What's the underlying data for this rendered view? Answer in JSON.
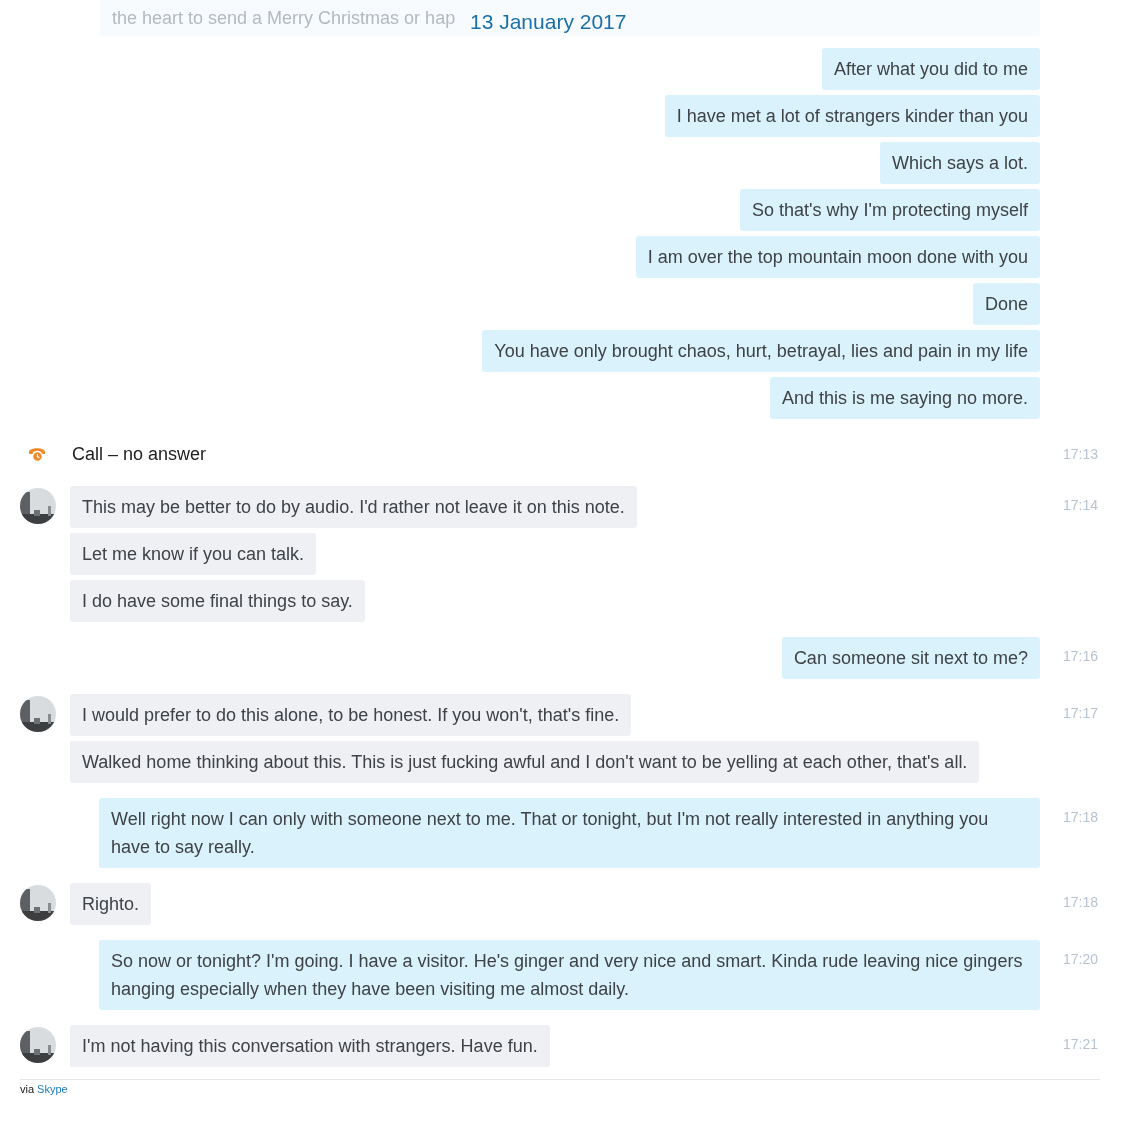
{
  "faded_message": "the heart to send a Merry Christmas or hap",
  "date_header": "13 January 2017",
  "groups": [
    {
      "kind": "out",
      "messages": [
        "After what you did to me",
        "I have met a lot of strangers kinder than you",
        "Which says a lot.",
        "So that's why I'm protecting myself",
        "I am over the top mountain moon done with you",
        "Done",
        "You have only brought chaos, hurt, betrayal, lies and pain in my life",
        "And this is me saying no more."
      ]
    },
    {
      "kind": "call",
      "text": "Call – no answer",
      "time": "17:13"
    },
    {
      "kind": "in",
      "time": "17:14",
      "messages": [
        "This may be better to do by audio. I'd rather not leave it on this note.",
        "Let me know if you can talk.",
        "I do have some final things to say."
      ]
    },
    {
      "kind": "out",
      "time": "17:16",
      "messages": [
        "Can someone sit next to me?"
      ]
    },
    {
      "kind": "in",
      "time": "17:17",
      "messages": [
        "I would prefer to do this alone, to be honest. If you won't, that's fine.",
        "Walked home thinking about this. This is just fucking awful and I don't want to be yelling at each other, that's all."
      ]
    },
    {
      "kind": "out",
      "time": "17:18",
      "messages": [
        "Well right now I can only with someone next to me. That or tonight, but I'm not really interested in anything you have to say really."
      ]
    },
    {
      "kind": "in",
      "time": "17:18",
      "messages": [
        "Righto."
      ]
    },
    {
      "kind": "out",
      "time": "17:20",
      "messages": [
        "So now or tonight? I'm going. I have a visitor. He's ginger and very nice and smart. Kinda rude leaving nice gingers hanging especially when they have been visiting me almost daily."
      ]
    },
    {
      "kind": "in",
      "time": "17:21",
      "messages": [
        "I'm not having this conversation with strangers. Have fun."
      ]
    }
  ],
  "footer": {
    "prefix": "via",
    "link": "Skype"
  }
}
